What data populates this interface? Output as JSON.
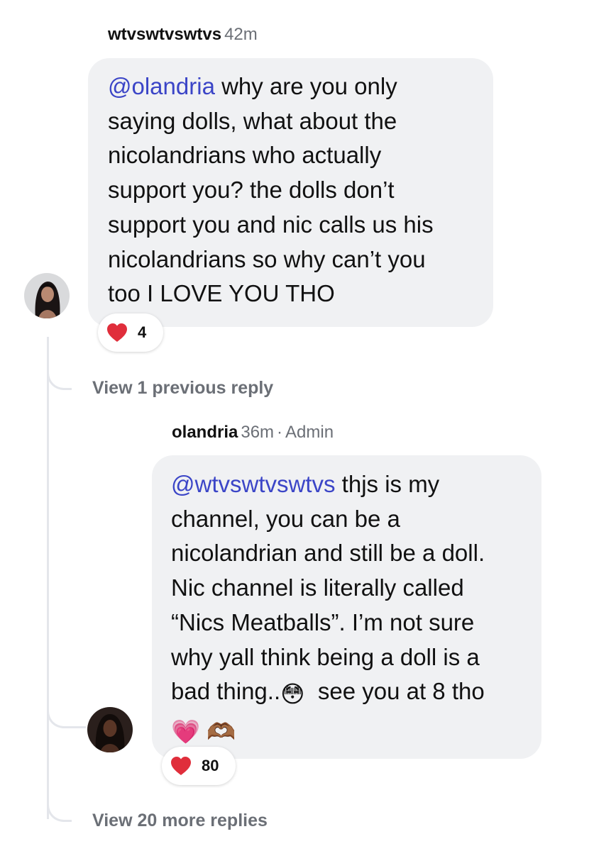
{
  "comment1": {
    "username": "wtvswtvswtvs",
    "time": "42m",
    "mention": "@olandria",
    "lines": [
      " why are you only",
      "saying dolls, what about the",
      "nicolandrians who actually",
      "support you? the dolls don’t",
      "support you and nic calls us his",
      "nicolandrians so why can’t you",
      "too I LOVE YOU THO"
    ],
    "reaction": {
      "icon": "heart-icon",
      "count": "4"
    }
  },
  "view_previous": "View 1 previous reply",
  "reply": {
    "username": "olandria",
    "time": "36m",
    "separator": "·",
    "role": "Admin",
    "mention": "@wtvswtvswtvs",
    "lines": [
      " thjs is my",
      "channel, you can be a",
      "nicolandrian and still be a doll.",
      "Nic channel is literally called",
      "“Nics Meatballs”. I’m not sure",
      "why yall think being a doll is a",
      "bad thing..",
      "😳",
      "  see you at 8 tho",
      "💗",
      "🫶🏾"
    ],
    "reaction": {
      "icon": "heart-icon",
      "count": "80"
    }
  },
  "view_more": "View 20 more replies",
  "colors": {
    "mention": "#3b45c7",
    "bubble": "#f0f1f3",
    "meta": "#6b6f76",
    "heart": "#e02e3b",
    "thread_line": "#e4e6eb"
  }
}
